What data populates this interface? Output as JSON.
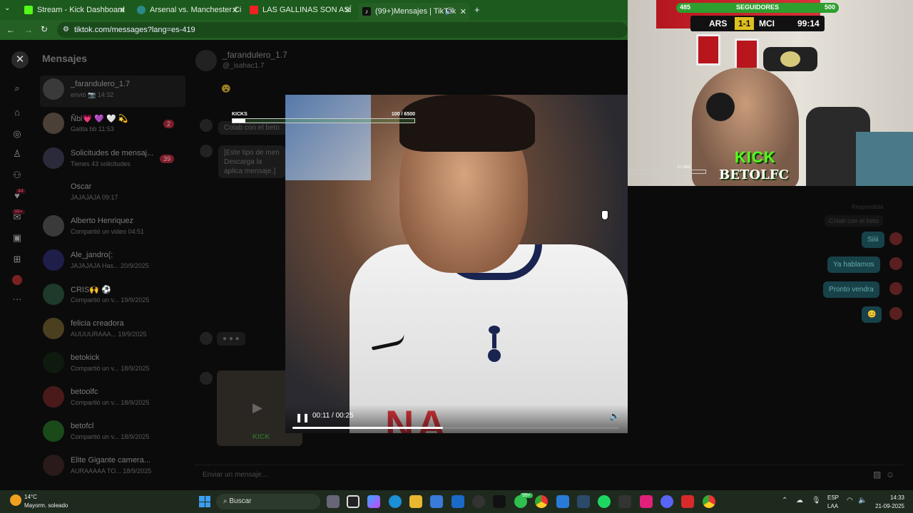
{
  "browser": {
    "tabs": [
      {
        "label": "Stream - Kick Dashboard",
        "icon": "kick-icon",
        "color": "#53fc18"
      },
      {
        "label": "Arsenal vs. Manchester City | D",
        "icon": "globe-icon",
        "color": "#3aa"
      },
      {
        "label": "LAS GALLINAS SON ASÍ ← con",
        "icon": "youtube-icon",
        "color": "#e22"
      },
      {
        "label": "(99+)Mensajes | TikTok",
        "icon": "tiktok-icon",
        "color": "#111"
      }
    ],
    "url": "tiktok.com/messages?lang=es-419"
  },
  "messages": {
    "title": "Mensajes",
    "rail_badges": [
      "44",
      "99+"
    ],
    "conversations": [
      {
        "name": "_farandulero_1.7",
        "preview": "envió 📷 14:32",
        "badge": ""
      },
      {
        "name": "Ñbl💗 💜 🤍 💫",
        "preview": "Gatita bb 11:53",
        "badge": "2"
      },
      {
        "name": "Solicitudes de mensaj...",
        "preview": "Tienes 43 solicitudes",
        "badge": "39"
      },
      {
        "name": "Oscar",
        "preview": "JAJAJAJA 09:17",
        "badge": ""
      },
      {
        "name": "Alberto Henriquez",
        "preview": "Compartió un video 04:51",
        "badge": ""
      },
      {
        "name": "Ale_jandro(:",
        "preview": "JAJAJAJA Has... 20/9/2025",
        "badge": ""
      },
      {
        "name": "CRIS🙌 ⚽",
        "preview": "Compartió un v... 19/9/2025",
        "badge": ""
      },
      {
        "name": "felicia creadora",
        "preview": "AUUUURAAA... 19/9/2025",
        "badge": ""
      },
      {
        "name": "betokick",
        "preview": "Compartió un v... 18/9/2025",
        "badge": ""
      },
      {
        "name": "betoolfc",
        "preview": "Compartió un v... 18/9/2025",
        "badge": ""
      },
      {
        "name": "betofcl",
        "preview": "Compartió un v... 18/9/2025",
        "badge": ""
      },
      {
        "name": "Elite Gigante camera...",
        "preview": "AURAAAAA TO... 18/9/2025",
        "badge": ""
      }
    ]
  },
  "chat": {
    "username": "_farandulero_1.7",
    "handle": "@_isahac1.7",
    "left_bubbles": [
      "Colab con el beto",
      "[Este tipo de men Descarga la aplica mensaje.]"
    ],
    "reaction": "😮",
    "dots": "● ● ●",
    "right_label": "Respondiste",
    "right_quote": "Colab con el beto",
    "right_bubbles": [
      "Siiii",
      "Ya hablamos",
      "Pronto vendra",
      "😊"
    ],
    "composer_placeholder": "Enviar un mensaje..."
  },
  "video": {
    "time": "00:11 / 00:25",
    "progress": 0.46,
    "sponsor_text": "NA",
    "kicks_label": "KICKS",
    "kicks_value": "100 / 6500",
    "kicks_progress": 0.07
  },
  "stream_overlay": {
    "followers_current": "485",
    "followers_label": "SEGUIDORES",
    "followers_goal": "500",
    "followers_progress": 0.97,
    "home": "ARS",
    "score": "1-1",
    "away": "MCI",
    "clock": "99:14",
    "kick_logo": "KICK",
    "streamer": "BETOLFC",
    "mini_bar": "0 / 1500"
  },
  "taskbar": {
    "temp": "14°C",
    "weather": "Mayorm. soleado",
    "search": "Buscar",
    "chat_badge": "99+",
    "lang1": "ESP",
    "lang2": "LAA",
    "time": "14:33",
    "date": "21-09-2025"
  }
}
